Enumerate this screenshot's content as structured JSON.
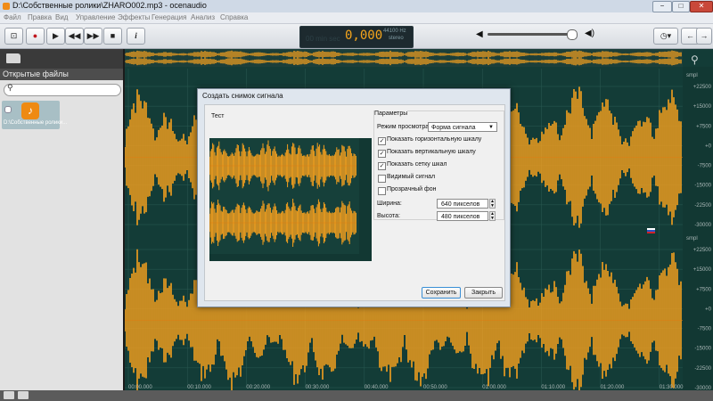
{
  "window": {
    "title": "D:\\Собственные ролики\\ZHARO002.mp3 - ocenaudio",
    "controls": [
      "−",
      "□",
      "✕"
    ]
  },
  "menu": [
    "Файл",
    "Правка",
    "Вид",
    "Управление",
    "Эффекты",
    "Генерация",
    "Анализ",
    "Справка"
  ],
  "transport": {
    "time": "0,000",
    "sample_rate": "44100 Hz",
    "channels": "stereo",
    "ghost_digits": "00 min sec"
  },
  "volume": {
    "level": 0.94
  },
  "sidebar": {
    "header": "Открытые файлы",
    "search_placeholder": "",
    "files": [
      {
        "name": "D:\\Собственные ролики...",
        "icon": "music-note-icon"
      }
    ]
  },
  "waveform": {
    "colors": {
      "background": "#133c37",
      "signal": "#f5a01e",
      "grid": "#2b5a52"
    },
    "unit_label": "smpl",
    "y_ticks_top": [
      "+22500",
      "+15000",
      "+7500",
      "+0",
      "-7500",
      "-15000",
      "-22500",
      "-30000"
    ],
    "y_ticks_bottom": [
      "+22500",
      "+15000",
      "+7500",
      "+0",
      "-7500",
      "-15000",
      "-22500",
      "-30000"
    ],
    "time_ticks": [
      "00:00.000",
      "00:10.000",
      "00:20.000",
      "00:30.000",
      "00:40.000",
      "00:50.000",
      "01:00.000",
      "01:10.000",
      "01:20.000",
      "01:30.000"
    ]
  },
  "dialog": {
    "title": "Создать снимок сигнала",
    "preview_label": "Тест",
    "params_label": "Параметры",
    "view_mode_label": "Режим просмотра:",
    "view_mode_value": "Форма сигнала",
    "options": [
      {
        "label": "Показать горизонтальную шкалу",
        "checked": true
      },
      {
        "label": "Показать вертикальную шкалу",
        "checked": true
      },
      {
        "label": "Показать сетку шкал",
        "checked": true
      },
      {
        "label": "Видимый сигнал",
        "checked": false
      },
      {
        "label": "Прозрачный фон",
        "checked": false
      }
    ],
    "width_label": "Ширина:",
    "width_value": "640 пикселов",
    "height_label": "Высота:",
    "height_value": "480 пикселов",
    "save_label": "Сохранить",
    "close_label": "Закрыть"
  }
}
